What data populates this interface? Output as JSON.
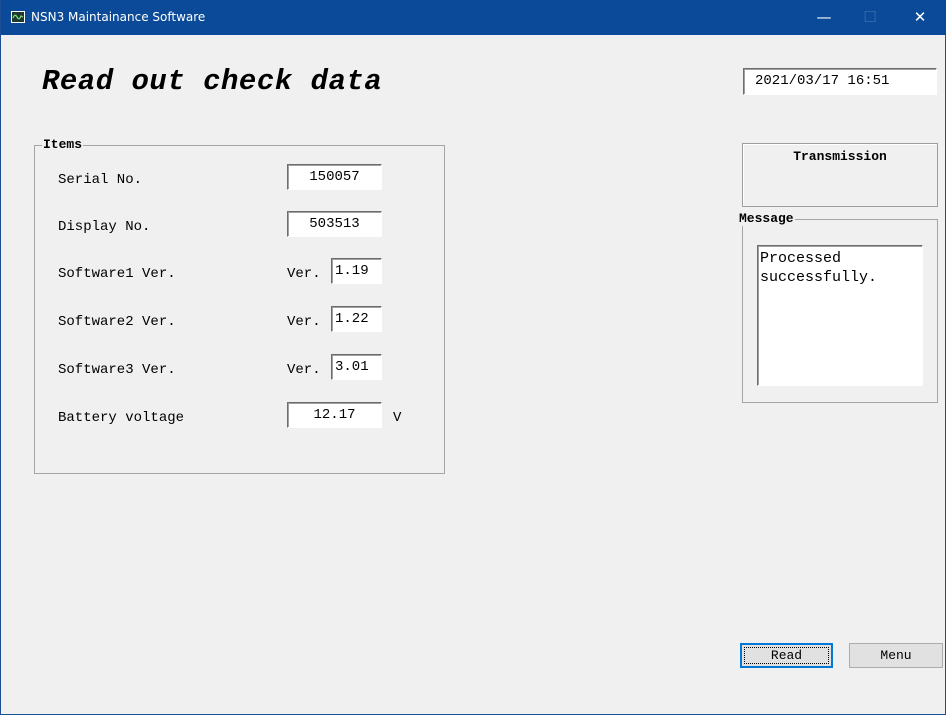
{
  "window": {
    "title": "NSN3 Maintainance Software",
    "controls": {
      "minimize": "—",
      "maximize": "☐",
      "close": "✕"
    },
    "accent_color": "#0b4a98"
  },
  "header": {
    "page_title": "Read out check data",
    "datetime": "2021/03/17 16:51"
  },
  "items": {
    "group_label": "Items",
    "serial_label": "Serial No.",
    "serial_value": "150057",
    "display_label": "Display No.",
    "display_value": "503513",
    "sw1_label": "Software1 Ver.",
    "sw1_prefix": "Ver.",
    "sw1_value": "1.19",
    "sw2_label": "Software2 Ver.",
    "sw2_prefix": "Ver.",
    "sw2_value": "1.22",
    "sw3_label": "Software3 Ver.",
    "sw3_prefix": "Ver.",
    "sw3_value": "3.01",
    "battery_label": "Battery voltage",
    "battery_value": "12.17",
    "battery_unit": "V"
  },
  "transmission": {
    "label": "Transmission"
  },
  "message": {
    "group_label": "Message",
    "text": "Processed successfully."
  },
  "buttons": {
    "read_label": "Read",
    "menu_label": "Menu"
  }
}
